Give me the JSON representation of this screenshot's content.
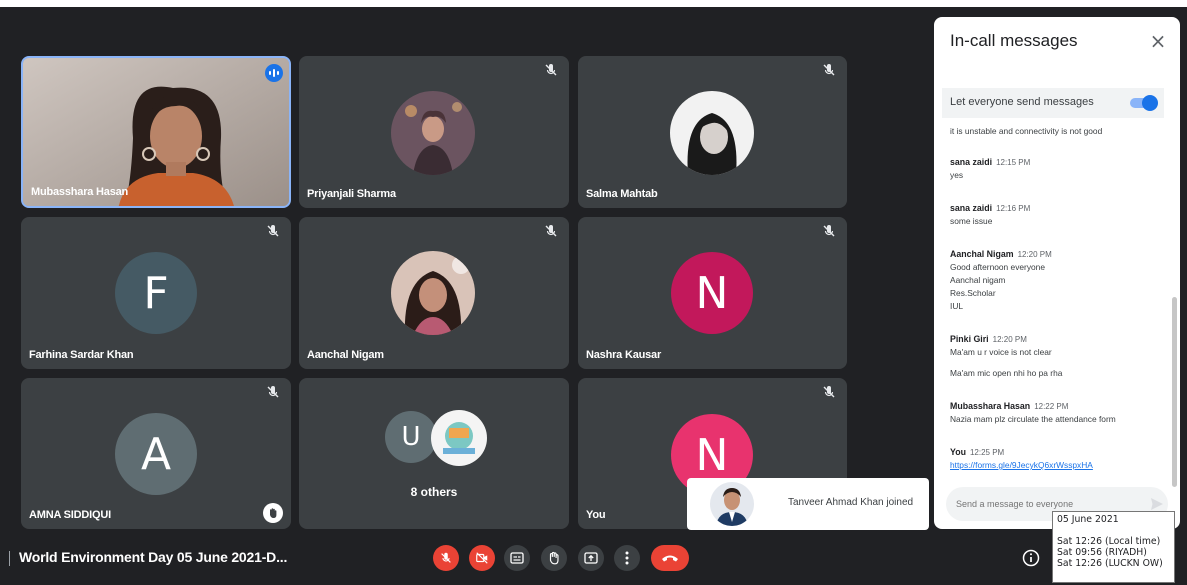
{
  "chat": {
    "title": "In-call messages",
    "close_glyph": "×",
    "toggle_label": "Let everyone send messages",
    "toggle_on": true,
    "messages": [
      {
        "sender": "",
        "time": "",
        "lines": [
          "it is unstable and connectivity is not good"
        ]
      },
      {
        "sender": "sana zaidi",
        "time": "12:15 PM",
        "lines": [
          "yes"
        ]
      },
      {
        "sender": "sana zaidi",
        "time": "12:16 PM",
        "lines": [
          "some issue"
        ]
      },
      {
        "sender": "Aanchal Nigam",
        "time": "12:20 PM",
        "lines": [
          "Good afternoon everyone",
          "Aanchal nigam",
          "Res.Scholar",
          "IUL"
        ]
      },
      {
        "sender": "Pinki Giri",
        "time": "12:20 PM",
        "lines": [
          "Ma'am u r voice is not clear",
          "Ma'am mic open nhi ho pa rha"
        ]
      },
      {
        "sender": "Mubasshara Hasan",
        "time": "12:22 PM",
        "lines": [
          "Nazia mam plz circulate the attendance form"
        ]
      },
      {
        "sender": "You",
        "time": "12:25 PM",
        "lines": [
          "https://forms.gle/9JecykQ6xrWsspxHA"
        ]
      }
    ],
    "input_placeholder": "Send a message to everyone"
  },
  "tiles": [
    {
      "name": "Mubasshara Hasan",
      "kind": "video"
    },
    {
      "name": "Priyanjali Sharma",
      "kind": "photo"
    },
    {
      "name": "Salma Mahtab",
      "kind": "photo"
    },
    {
      "name": "Farhina Sardar Khan",
      "kind": "letter",
      "letter": "F",
      "color": "#455a64"
    },
    {
      "name": "Aanchal Nigam",
      "kind": "photo"
    },
    {
      "name": "Nashra Kausar",
      "kind": "letter",
      "letter": "N",
      "color": "#c2185b"
    },
    {
      "name": "AMNA SIDDIQUI",
      "kind": "letter",
      "letter": "A",
      "color": "#5f6d72"
    },
    {
      "name": "8 others",
      "kind": "group",
      "letter": "U",
      "color": "#5f6d72"
    },
    {
      "name": "You",
      "kind": "letter",
      "letter": "N",
      "color": "#e8336e"
    }
  ],
  "toast": {
    "text": "Tanveer Ahmad Khan joined"
  },
  "tooltip": {
    "date": "05 June 2021",
    "lines": [
      "Sat 12:26  (Local time)",
      "Sat 09:56  (RIYADH)",
      "Sat 12:26  (LUCKN OW)"
    ]
  },
  "meeting": {
    "title": "World Environment Day 05 June 2021-D..."
  },
  "controls": [
    "mic-off-icon",
    "camera-off-icon",
    "captions-icon",
    "raise-hand-icon",
    "present-icon",
    "more-options-icon",
    "end-call-icon"
  ],
  "colors": {
    "accent": "#1a73e8",
    "danger": "#ea4335",
    "tile": "#3c4043",
    "background": "#202124"
  }
}
